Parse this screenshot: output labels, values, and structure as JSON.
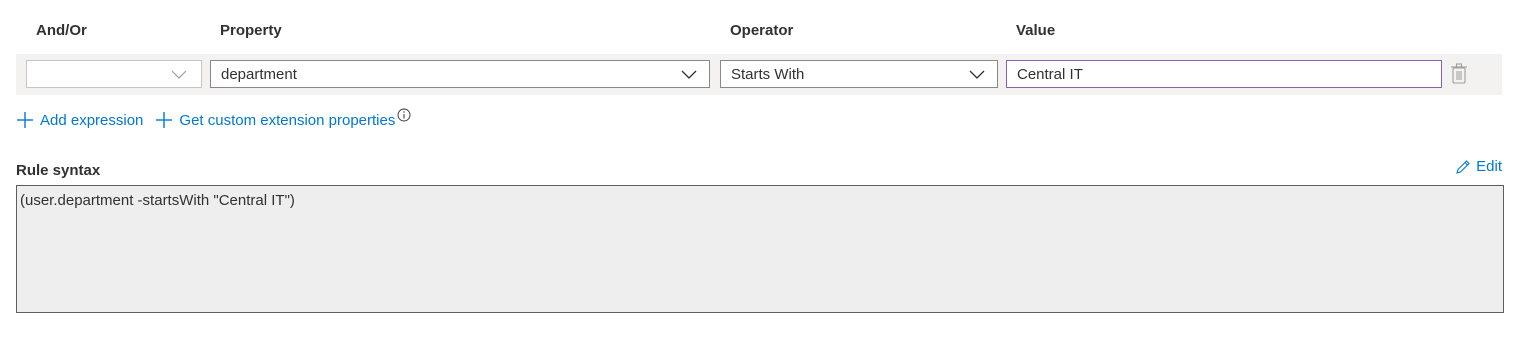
{
  "columns": {
    "and_or": "And/Or",
    "property": "Property",
    "operator": "Operator",
    "value": "Value"
  },
  "row": {
    "and_or_value": "",
    "property_value": "department",
    "operator_value": "Starts With",
    "value_value": "Central IT"
  },
  "actions": {
    "add_expression": "Add expression",
    "get_custom_extension": "Get custom extension properties"
  },
  "rule_syntax": {
    "title": "Rule syntax",
    "edit_label": "Edit",
    "text": "(user.department -startsWith \"Central IT\")"
  },
  "icons": {
    "dropdown": "chevron-down-icon",
    "delete": "trash-icon",
    "add": "plus-icon",
    "info": "info-icon",
    "edit": "pencil-icon"
  },
  "colors": {
    "link": "#0078d4",
    "row_band": "#f3f2f1",
    "value_border": "#8764b8",
    "rule_box_bg": "#eeeeee"
  }
}
